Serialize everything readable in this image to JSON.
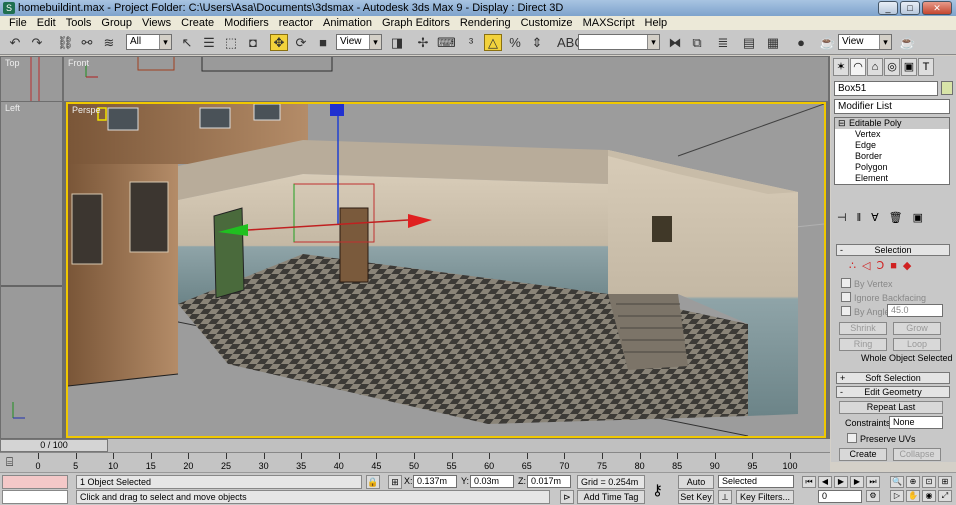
{
  "window": {
    "title": "homebuildint.max     - Project Folder: C:\\Users\\Asa\\Documents\\3dsmax     - Autodesk 3ds Max 9     - Display : Direct 3D",
    "minimize": "_",
    "maximize": "□",
    "close": "✕"
  },
  "menu": [
    "File",
    "Edit",
    "Tools",
    "Group",
    "Views",
    "Create",
    "Modifiers",
    "reactor",
    "Animation",
    "Graph Editors",
    "Rendering",
    "Customize",
    "MAXScript",
    "Help"
  ],
  "toolbar": {
    "selection_filter": "All",
    "reference_coord": "View",
    "named_selection": "",
    "render_view": "View"
  },
  "viewports": {
    "top_label": "Top",
    "front_label": "Front",
    "left_label": "Left",
    "perspective_label": "Perspe"
  },
  "command_panel": {
    "object_name": "Box51",
    "modifier_list": "Modifier List",
    "stack": {
      "root": "Editable Poly",
      "sub": [
        "Vertex",
        "Edge",
        "Border",
        "Polygon",
        "Element"
      ]
    },
    "selection": {
      "header": "Selection",
      "by_vertex": "By Vertex",
      "ignore_backfacing": "Ignore Backfacing",
      "by_angle": "By Angle:",
      "angle_value": "45.0",
      "shrink": "Shrink",
      "grow": "Grow",
      "ring": "Ring",
      "loop": "Loop",
      "status": "Whole Object Selected"
    },
    "soft_selection": "Soft Selection",
    "edit_geometry": {
      "header": "Edit Geometry",
      "repeat_last": "Repeat Last",
      "constraints_label": "Constraints:",
      "constraints_value": "None",
      "preserve_uvs": "Preserve UVs",
      "create": "Create",
      "collapse": "Collapse"
    }
  },
  "timeline": {
    "frame": "0 / 100",
    "ticks": [
      "0",
      "5",
      "10",
      "15",
      "20",
      "25",
      "30",
      "35",
      "40",
      "45",
      "50",
      "55",
      "60",
      "65",
      "70",
      "75",
      "80",
      "85",
      "90",
      "95",
      "100"
    ]
  },
  "status": {
    "selected": "1 Object Selected",
    "prompt": "Click and drag to select and move objects",
    "x_label": "X:",
    "x_value": "0.137m",
    "y_label": "Y:",
    "y_value": "0.03m",
    "z_label": "Z:",
    "z_value": "0.017m",
    "grid": "Grid = 0.254m",
    "add_time_tag": "Add Time Tag",
    "auto_key": "Auto Key",
    "set_key": "Set Key",
    "key_mode": "Selected",
    "key_filters": "Key Filters...",
    "current_frame": "0"
  },
  "colors": {
    "active_viewport_border": "#f0c800",
    "active_tool": "#f2d23c",
    "object_color_swatch": "#d8e4a8"
  }
}
